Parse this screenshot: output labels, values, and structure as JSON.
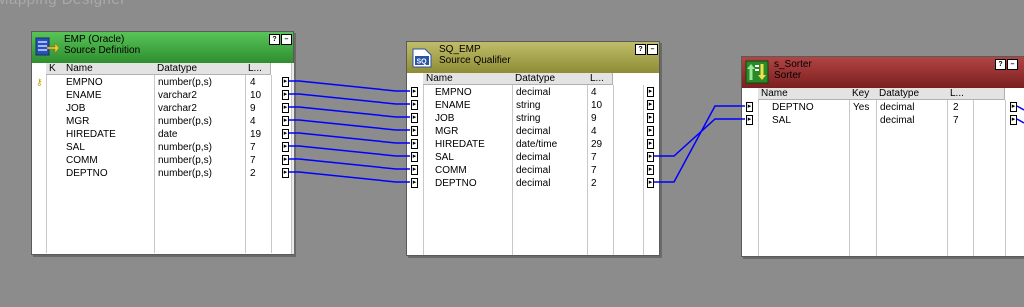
{
  "canvas": {
    "title": "Mapping Designer",
    "link_color": "#0000ff",
    "background": "#8c8c8c"
  },
  "emp": {
    "name": "EMP (Oracle)",
    "type": "Source Definition",
    "header_color": "#3ea83e",
    "columns": {
      "key": "K",
      "name": "Name",
      "datatype": "Datatype",
      "length": "L..."
    },
    "rows": [
      {
        "key_icon": "key-icon",
        "name": "EMPNO",
        "datatype": "number(p,s)",
        "length": "4"
      },
      {
        "name": "ENAME",
        "datatype": "varchar2",
        "length": "10"
      },
      {
        "name": "JOB",
        "datatype": "varchar2",
        "length": "9"
      },
      {
        "name": "MGR",
        "datatype": "number(p,s)",
        "length": "4"
      },
      {
        "name": "HIREDATE",
        "datatype": "date",
        "length": "19"
      },
      {
        "name": "SAL",
        "datatype": "number(p,s)",
        "length": "7"
      },
      {
        "name": "COMM",
        "datatype": "number(p,s)",
        "length": "7"
      },
      {
        "name": "DEPTNO",
        "datatype": "number(p,s)",
        "length": "2"
      }
    ]
  },
  "sq_emp": {
    "name": "SQ_EMP",
    "type": "Source Qualifier",
    "header_color": "#a3a14a",
    "columns": {
      "name": "Name",
      "datatype": "Datatype",
      "length": "L..."
    },
    "rows": [
      {
        "name": "EMPNO",
        "datatype": "decimal",
        "length": "4"
      },
      {
        "name": "ENAME",
        "datatype": "string",
        "length": "10"
      },
      {
        "name": "JOB",
        "datatype": "string",
        "length": "9"
      },
      {
        "name": "MGR",
        "datatype": "decimal",
        "length": "4"
      },
      {
        "name": "HIREDATE",
        "datatype": "date/time",
        "length": "29"
      },
      {
        "name": "SAL",
        "datatype": "decimal",
        "length": "7"
      },
      {
        "name": "COMM",
        "datatype": "decimal",
        "length": "7"
      },
      {
        "name": "DEPTNO",
        "datatype": "decimal",
        "length": "2"
      }
    ]
  },
  "sorter": {
    "name": "s_Sorter",
    "type": "Sorter",
    "header_color": "#8e2a2a",
    "columns": {
      "name": "Name",
      "key": "Key",
      "datatype": "Datatype",
      "length": "L..."
    },
    "rows": [
      {
        "name": "DEPTNO",
        "key": "Yes",
        "datatype": "decimal",
        "length": "2"
      },
      {
        "name": "SAL",
        "key": "",
        "datatype": "decimal",
        "length": "7"
      }
    ]
  },
  "controls": {
    "help": "?",
    "minimize": "–"
  }
}
